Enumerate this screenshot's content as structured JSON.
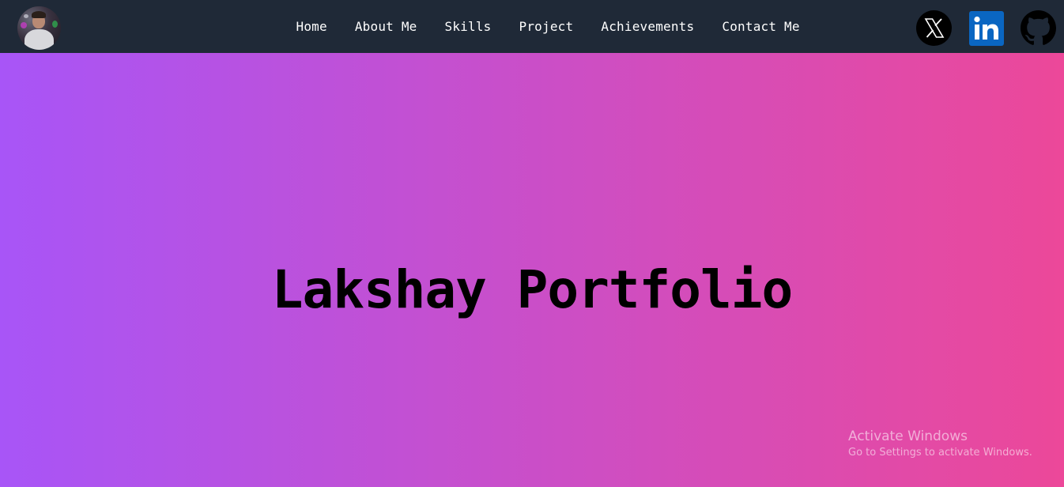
{
  "nav": {
    "links": [
      {
        "label": "Home"
      },
      {
        "label": "About Me"
      },
      {
        "label": "Skills"
      },
      {
        "label": "Project"
      },
      {
        "label": "Achievements"
      },
      {
        "label": "Contact Me"
      }
    ],
    "social": {
      "x": "x-twitter-icon",
      "linkedin": "linkedin-icon",
      "github": "github-icon"
    }
  },
  "hero": {
    "title": "Lakshay Portfolio",
    "gradient_start": "#a855f7",
    "gradient_end": "#ec4899"
  },
  "watermark": {
    "title": "Activate Windows",
    "subtitle": "Go to Settings to activate Windows."
  },
  "colors": {
    "navbar": "#1f2937",
    "nav_text": "#ffffff",
    "linkedin_blue": "#0a66c2"
  }
}
